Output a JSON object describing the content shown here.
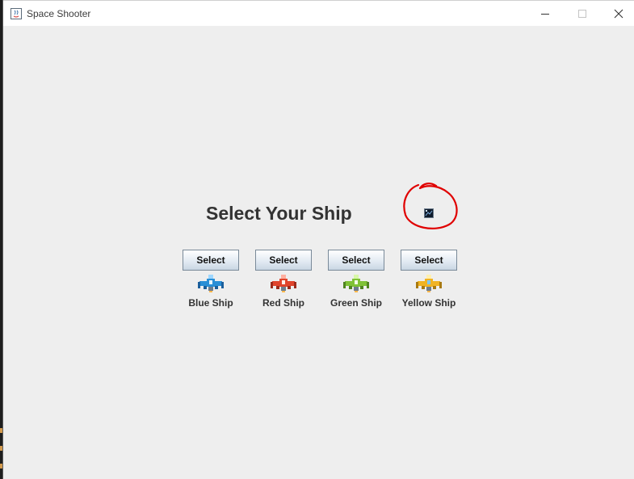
{
  "window": {
    "title": "Space Shooter",
    "controls": [
      "minimize-icon",
      "maximize-icon",
      "close-icon"
    ]
  },
  "main": {
    "heading": "Select Your Ship",
    "broken_image_icon": "broken-image-icon",
    "annotation_color": "#e00000"
  },
  "ships": [
    {
      "button": "Select",
      "label": "Blue Ship",
      "color": "#2a8fd6"
    },
    {
      "button": "Select",
      "label": "Red Ship",
      "color": "#e0442c"
    },
    {
      "button": "Select",
      "label": "Green Ship",
      "color": "#7fc236"
    },
    {
      "button": "Select",
      "label": "Yellow Ship",
      "color": "#f0b323"
    }
  ]
}
